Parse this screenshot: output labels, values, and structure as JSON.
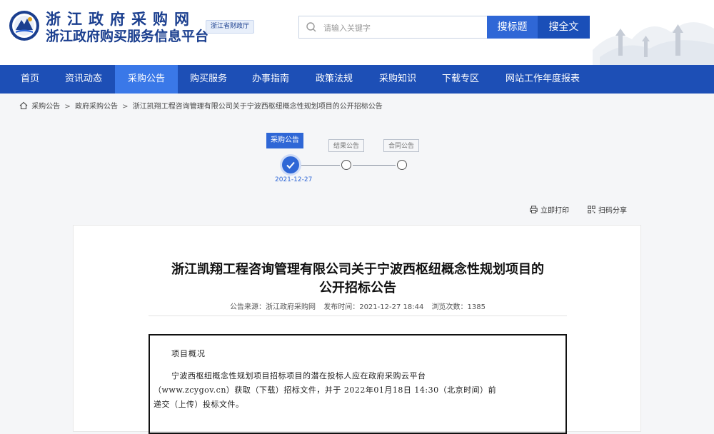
{
  "header": {
    "title_line1": "浙江政府采购网",
    "title_line2": "浙江政府购买服务信息平台",
    "dept_tag": "浙江省财政厅",
    "search_placeholder": "请输入关键字",
    "btn_search_title": "搜标题",
    "btn_search_all": "搜全文"
  },
  "nav": {
    "items": [
      "首页",
      "资讯动态",
      "采购公告",
      "购买服务",
      "办事指南",
      "政策法规",
      "采购知识",
      "下载专区",
      "网站工作年度报表"
    ],
    "active": "采购公告"
  },
  "breadcrumb": {
    "items": [
      "采购公告",
      "政府采购公告",
      "浙江凯翔工程咨询管理有限公司关于宁波西枢纽概念性规划项目的公开招标公告"
    ],
    "separator": ">"
  },
  "progress": {
    "steps": [
      "采购公告",
      "结果公告",
      "合同公告"
    ],
    "current_index": 0,
    "date": "2021-12-27"
  },
  "actions": {
    "print": "立即打印",
    "share": "扫码分享"
  },
  "article": {
    "title_line1": "浙江凯翔工程咨询管理有限公司关于宁波西枢纽概念性规划项目的",
    "title_line2": "公开招标公告",
    "source": "公告来源：浙江政府采购网",
    "published": "发布时间：2021-12-27 18:44",
    "views": "浏览次数：1385",
    "overview_heading": "项目概况",
    "overview_line1": "宁波西枢纽概念性规划项目招标项目的潜在投标人应在政府采购云平台",
    "overview_line2": "（www.zcygov.cn）获取（下载）招标文件，并于 2022年01月18日 14:30（北京时间）前",
    "overview_line3": "递交（上传）投标文件。"
  },
  "colors": {
    "nav_bg": "#1d4fb6",
    "nav_active": "#3a78e8",
    "brand_text": "#1b3f8f",
    "accent": "#2f67d6"
  }
}
